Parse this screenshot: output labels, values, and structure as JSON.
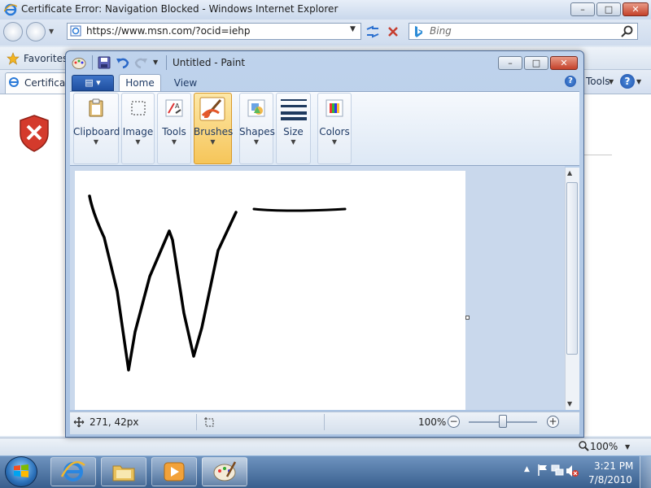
{
  "ie": {
    "title": "Certificate Error: Navigation Blocked - Windows Internet Explorer",
    "address_url": "https://www.msn.com/?ocid=iehp",
    "search_placeholder": "Bing",
    "favorites_label": "Favorites",
    "tab_label": "Certificat",
    "tools_label": "Tools",
    "zoom_label": "100%",
    "win_buttons": {
      "minimize": "–",
      "maximize": "□",
      "close": "✕"
    }
  },
  "paint": {
    "title": "Untitled - Paint",
    "tabs": {
      "home": "Home",
      "view": "View"
    },
    "groups": [
      {
        "label": "Clipboard"
      },
      {
        "label": "Image"
      },
      {
        "label": "Tools"
      },
      {
        "label": "Brushes"
      },
      {
        "label": "Shapes"
      },
      {
        "label": "Size"
      },
      {
        "label": "Colors"
      }
    ],
    "status": {
      "position": "271, 42px",
      "zoom": "100%"
    }
  },
  "taskbar": {
    "time": "3:21 PM",
    "date": "7/8/2010"
  },
  "colors": {
    "ink": "#000000",
    "ie_error_red": "#d43a2c",
    "paint_file_tab": "#2a5cb0"
  }
}
